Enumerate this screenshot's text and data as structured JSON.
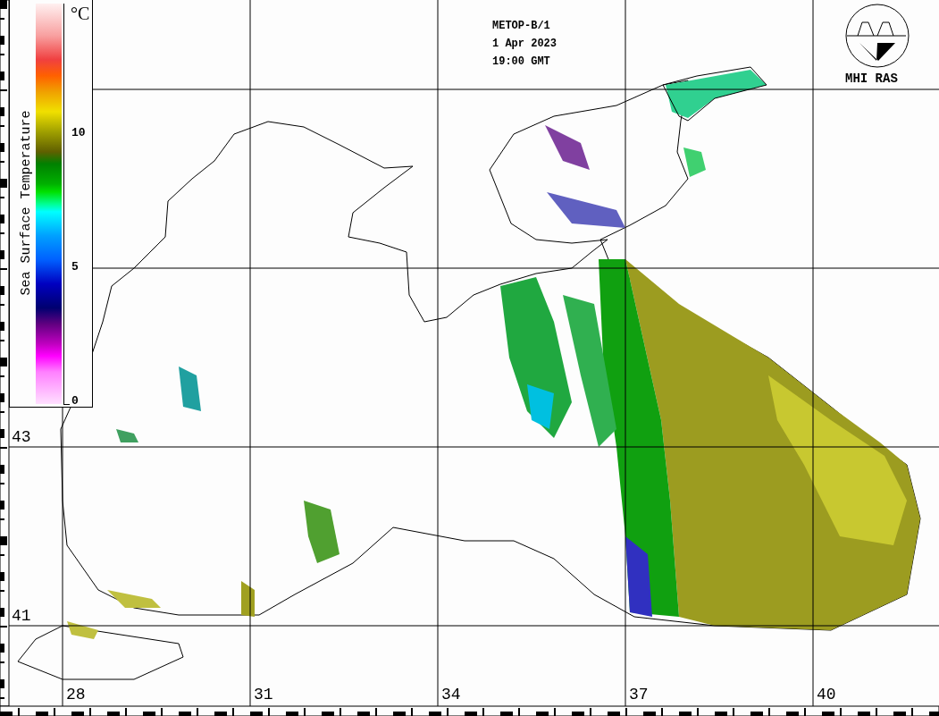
{
  "header": {
    "lines": [
      "METOP-B/1",
      "1 Apr 2023",
      "19:00 GMT"
    ]
  },
  "logo": {
    "label": "MHI RAS"
  },
  "legend": {
    "title": "Sea Surface Temperature",
    "unit": "°C",
    "ticks": [
      {
        "label": "10",
        "level": 0.67
      },
      {
        "label": "5",
        "level": 0.335
      },
      {
        "label": "0",
        "level": 0
      }
    ]
  },
  "latitudes": [
    "43",
    "41"
  ],
  "longitudes": [
    "28",
    "31",
    "34",
    "37",
    "40"
  ]
}
